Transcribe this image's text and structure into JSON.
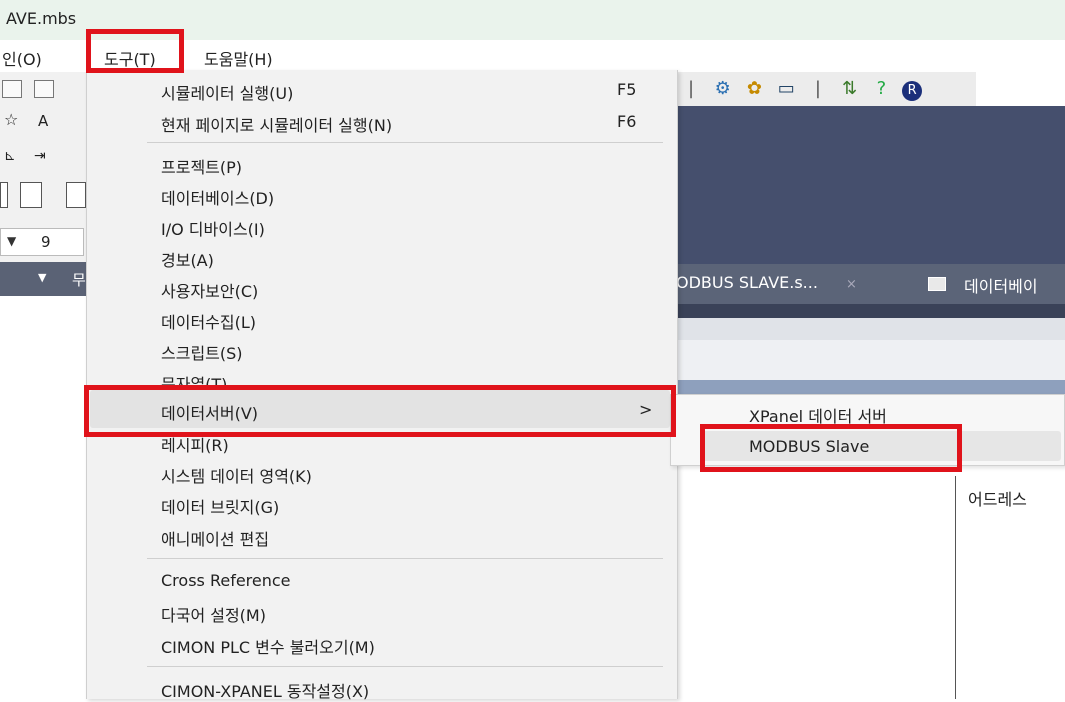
{
  "window": {
    "title": "AVE.mbs"
  },
  "menubar": {
    "items": [
      "인(O)",
      "도구(T)",
      "도움말(H)"
    ]
  },
  "toolbar": {
    "left_label": "A",
    "combo_value": "9",
    "dark_strip_glyph": "무"
  },
  "tabs": [
    {
      "label": "ODBUS SLAVE.s...",
      "close": "×"
    },
    {
      "label": "데이터베이"
    }
  ],
  "tools_menu": {
    "items": [
      {
        "label": "시뮬레이터 실행(U)",
        "shortcut": "F5"
      },
      {
        "label": "현재 페이지로 시뮬레이터 실행(N)",
        "shortcut": "F6"
      },
      {
        "label": "프로젝트(P)"
      },
      {
        "label": "데이터베이스(D)"
      },
      {
        "label": "I/O 디바이스(I)"
      },
      {
        "label": "경보(A)"
      },
      {
        "label": "사용자보안(C)"
      },
      {
        "label": "데이터수집(L)"
      },
      {
        "label": "스크립트(S)"
      },
      {
        "label": "문자열(T)"
      },
      {
        "label": "데이터서버(V)",
        "submenu_arrow": ">"
      },
      {
        "label": "레시피(R)"
      },
      {
        "label": "시스템 데이터 영역(K)"
      },
      {
        "label": "데이터 브릿지(G)"
      },
      {
        "label": "애니메이션 편집"
      },
      {
        "label": "Cross Reference"
      },
      {
        "label": "다국어 설정(M)"
      },
      {
        "label": "CIMON PLC 변수 불러오기(M)"
      },
      {
        "label": "CIMON-XPANEL 동작설정(X)"
      }
    ]
  },
  "data_server_submenu": {
    "items": [
      {
        "label": "XPanel 데이터 서버"
      },
      {
        "label": "MODBUS Slave"
      }
    ]
  },
  "table": {
    "column_header": "어드레스"
  },
  "colors": {
    "highlight_border": "#e0131b",
    "menu_background": "#f2f2f2",
    "workspace_navy": "#454f6d"
  }
}
